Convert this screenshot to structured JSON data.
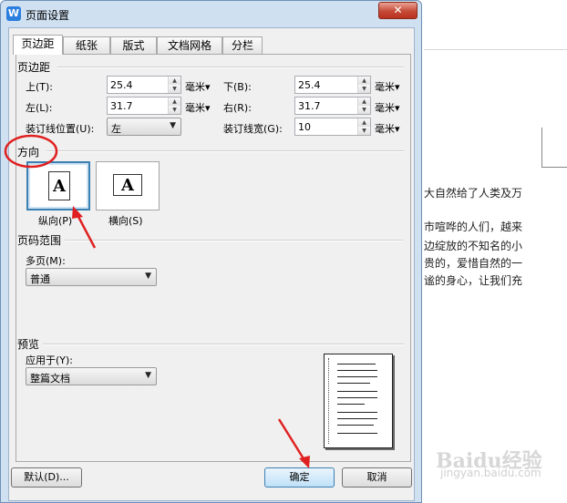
{
  "dialog": {
    "title": "页面设置",
    "app_icon": "W",
    "close_label": "✕",
    "tabs": [
      {
        "label": "页边距",
        "active": true
      },
      {
        "label": "纸张"
      },
      {
        "label": "版式"
      },
      {
        "label": "文档网格"
      },
      {
        "label": "分栏"
      }
    ],
    "margins": {
      "section": "页边距",
      "top_label": "上(T):",
      "top_value": "25.4",
      "bottom_label": "下(B):",
      "bottom_value": "25.4",
      "left_label": "左(L):",
      "left_value": "31.7",
      "right_label": "右(R):",
      "right_value": "31.7",
      "gutter_pos_label": "装订线位置(U):",
      "gutter_pos_value": "左",
      "gutter_width_label": "装订线宽(G):",
      "gutter_width_value": "10",
      "unit": "毫米"
    },
    "orientation": {
      "section": "方向",
      "portrait_label": "纵向(P)",
      "landscape_label": "横向(S)",
      "icon_letter": "A",
      "selected": "portrait"
    },
    "page_range": {
      "section": "页码范围",
      "multi_label": "多页(M):",
      "multi_value": "普通"
    },
    "preview": {
      "section": "预览",
      "apply_label": "应用于(Y):",
      "apply_value": "整篇文档"
    },
    "buttons": {
      "default": "默认(D)...",
      "ok": "确定",
      "cancel": "取消"
    }
  },
  "background_doc": {
    "lines": [
      "大自然给了人类及万",
      "市喧哗的人们，越来",
      "边绽放的不知名的小",
      "贵的，爱惜自然的一",
      "谧的身心，让我们充"
    ]
  },
  "watermark": {
    "text": "Baidu经验",
    "sub": "jingyan.baidu.com"
  },
  "colors": {
    "annotation": "#e02020",
    "selection": "#3c7fb1",
    "title_bg": "#cfe0f1"
  }
}
